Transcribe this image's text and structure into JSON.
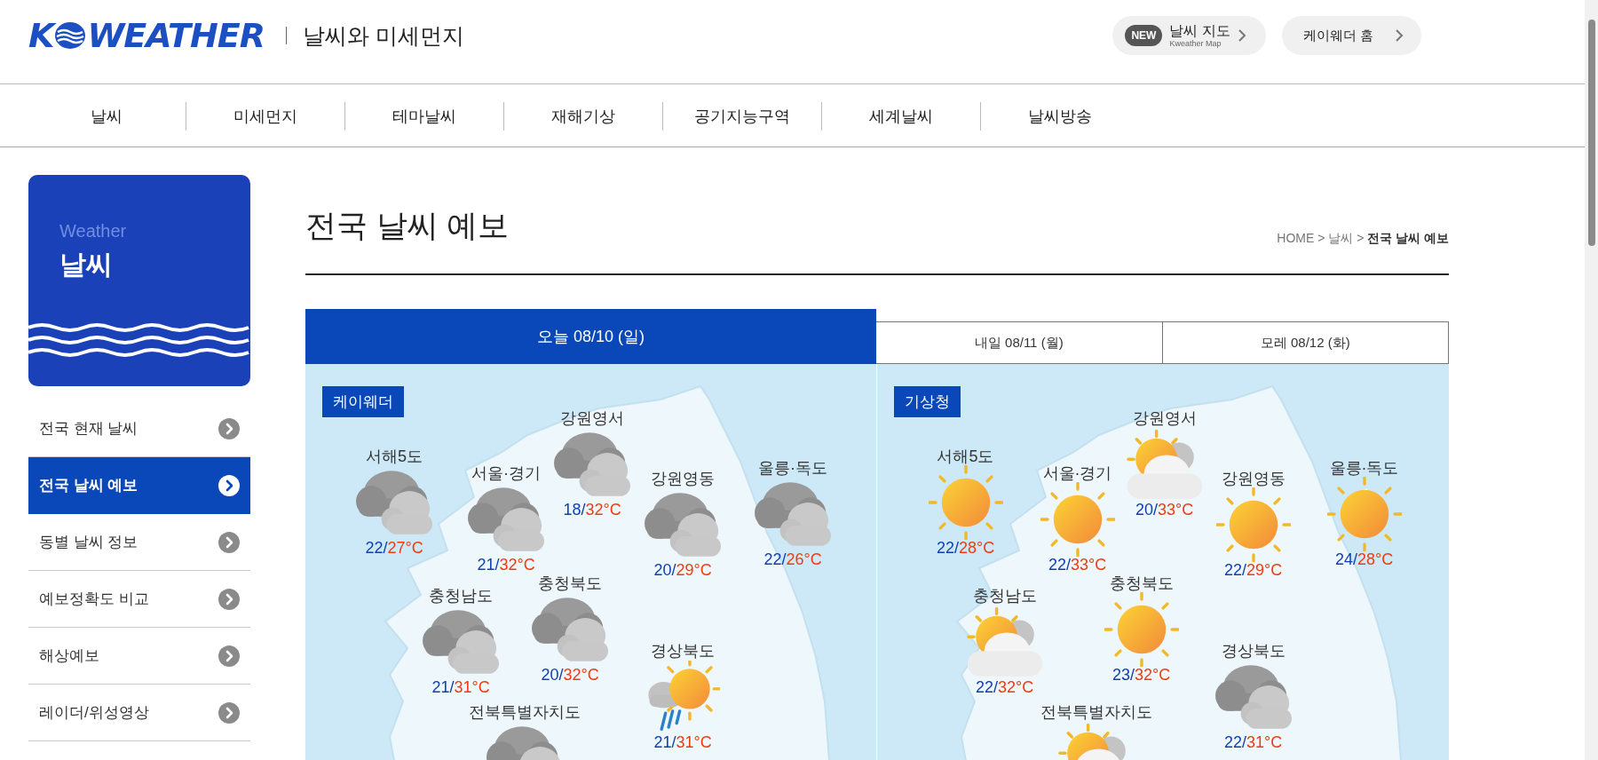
{
  "header": {
    "logo": {
      "left": "K",
      "right": "WEATHER"
    },
    "site_subtitle": "날씨와 미세먼지",
    "buttons": [
      {
        "kind": "map",
        "badge": "NEW",
        "label": "날씨 지도",
        "sublabel": "Kweather Map"
      },
      {
        "kind": "home",
        "label": "케이웨더 홈"
      }
    ]
  },
  "nav": [
    "날씨",
    "미세먼지",
    "테마날씨",
    "재해기상",
    "공기지능구역",
    "세계날씨",
    "날씨방송"
  ],
  "sidebar": {
    "card": {
      "caption": "Weather",
      "title": "날씨"
    },
    "items": [
      {
        "label": "전국 현재 날씨",
        "selected": false
      },
      {
        "label": "전국 날씨 예보",
        "selected": true
      },
      {
        "label": "동별 날씨 정보",
        "selected": false
      },
      {
        "label": "예보정확도 비교",
        "selected": false
      },
      {
        "label": "해상예보",
        "selected": false
      },
      {
        "label": "레이더/위성영상",
        "selected": false
      }
    ]
  },
  "page": {
    "title": "전국 날씨 예보",
    "breadcrumb": "HOME > 날씨 > **전국 날씨 예보**"
  },
  "tabs": [
    {
      "label": "오늘 08/10 (일)",
      "selected": true
    },
    {
      "label": "내일 08/11 (월)",
      "selected": false
    },
    {
      "label": "모레 08/12 (화)",
      "selected": false
    }
  ],
  "panels": [
    {
      "source": "케이웨더",
      "regions": [
        {
          "name": "서해5도",
          "kind": "cloudy",
          "temp": "22/27°C"
        },
        {
          "name": "서울·경기",
          "kind": "cloudy",
          "temp": "21/32°C"
        },
        {
          "name": "강원영서",
          "kind": "cloudy",
          "temp": "18/32°C"
        },
        {
          "name": "강원영동",
          "kind": "cloudy",
          "temp": "20/29°C"
        },
        {
          "name": "울릉·독도",
          "kind": "cloudy",
          "temp": "22/26°C"
        },
        {
          "name": "충청남도",
          "kind": "cloudy",
          "temp": "21/31°C"
        },
        {
          "name": "충청북도",
          "kind": "cloudy",
          "temp": "20/32°C"
        },
        {
          "name": "경상북도",
          "kind": "sunrain",
          "temp": "21/31°C"
        },
        {
          "name": "전북특별자치도",
          "kind": "cloudy"
        }
      ]
    },
    {
      "source": "기상청",
      "regions": [
        {
          "name": "서해5도",
          "kind": "sunny",
          "temp": "22/28°C"
        },
        {
          "name": "서울·경기",
          "kind": "sunny",
          "temp": "22/33°C"
        },
        {
          "name": "강원영서",
          "kind": "partlycloudy",
          "temp": "20/33°C"
        },
        {
          "name": "강원영동",
          "kind": "sunny",
          "temp": "22/29°C"
        },
        {
          "name": "울릉·독도",
          "kind": "sunny",
          "temp": "24/28°C"
        },
        {
          "name": "충청남도",
          "kind": "partlycloudy",
          "temp": "22/32°C"
        },
        {
          "name": "충청북도",
          "kind": "sunny",
          "temp": "23/32°C"
        },
        {
          "name": "경상북도",
          "kind": "cloudy",
          "temp": "22/31°C"
        },
        {
          "name": "전북특별자치도",
          "kind": "partlycloudy"
        }
      ]
    }
  ]
}
